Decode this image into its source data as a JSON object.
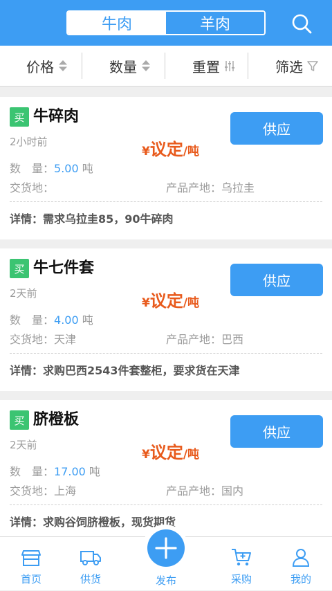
{
  "header": {
    "tabs": [
      {
        "label": "牛肉",
        "active": true
      },
      {
        "label": "羊肉",
        "active": false
      }
    ],
    "search_icon": "search-icon",
    "accent_color": "#3d9df3"
  },
  "filters": [
    {
      "label": "价格",
      "icon": "sort-icon"
    },
    {
      "label": "数量",
      "icon": "sort-icon"
    },
    {
      "label": "重置",
      "icon": "sliders-icon"
    },
    {
      "label": "筛选",
      "icon": "filter-icon"
    }
  ],
  "listings": [
    {
      "badge": "买",
      "title": "牛碎肉",
      "time": "2小时前",
      "price": {
        "symbol": "¥",
        "value": "议定",
        "unit": "/吨"
      },
      "button": "供应",
      "qty_label": "数　量：",
      "qty_value": "5.00",
      "qty_unit": "吨",
      "delivery_label": "交货地：",
      "delivery": "",
      "origin_label": "产品产地：",
      "origin": "乌拉圭",
      "detail_label": "详情：",
      "detail": "需求乌拉圭85，90牛碎肉"
    },
    {
      "badge": "买",
      "title": "牛七件套",
      "time": "2天前",
      "price": {
        "symbol": "¥",
        "value": "议定",
        "unit": "/吨"
      },
      "button": "供应",
      "qty_label": "数　量：",
      "qty_value": "4.00",
      "qty_unit": "吨",
      "delivery_label": "交货地：",
      "delivery": "天津",
      "origin_label": "产品产地：",
      "origin": "巴西",
      "detail_label": "详情：",
      "detail": "求购巴西2543件套整柜，要求货在天津"
    },
    {
      "badge": "买",
      "title": "脐橙板",
      "time": "2天前",
      "price": {
        "symbol": "¥",
        "value": "议定",
        "unit": "/吨"
      },
      "button": "供应",
      "qty_label": "数　量：",
      "qty_value": "17.00",
      "qty_unit": "吨",
      "delivery_label": "交货地：",
      "delivery": "上海",
      "origin_label": "产品产地：",
      "origin": "国内",
      "detail_label": "详情：",
      "detail": "求购谷饲脐橙板，现货期货"
    }
  ],
  "tabbar": [
    {
      "label": "首页",
      "icon": "store-icon"
    },
    {
      "label": "供货",
      "icon": "truck-icon"
    },
    {
      "label": "发布",
      "icon": "plus-icon"
    },
    {
      "label": "采购",
      "icon": "cart-icon"
    },
    {
      "label": "我的",
      "icon": "user-icon"
    }
  ]
}
